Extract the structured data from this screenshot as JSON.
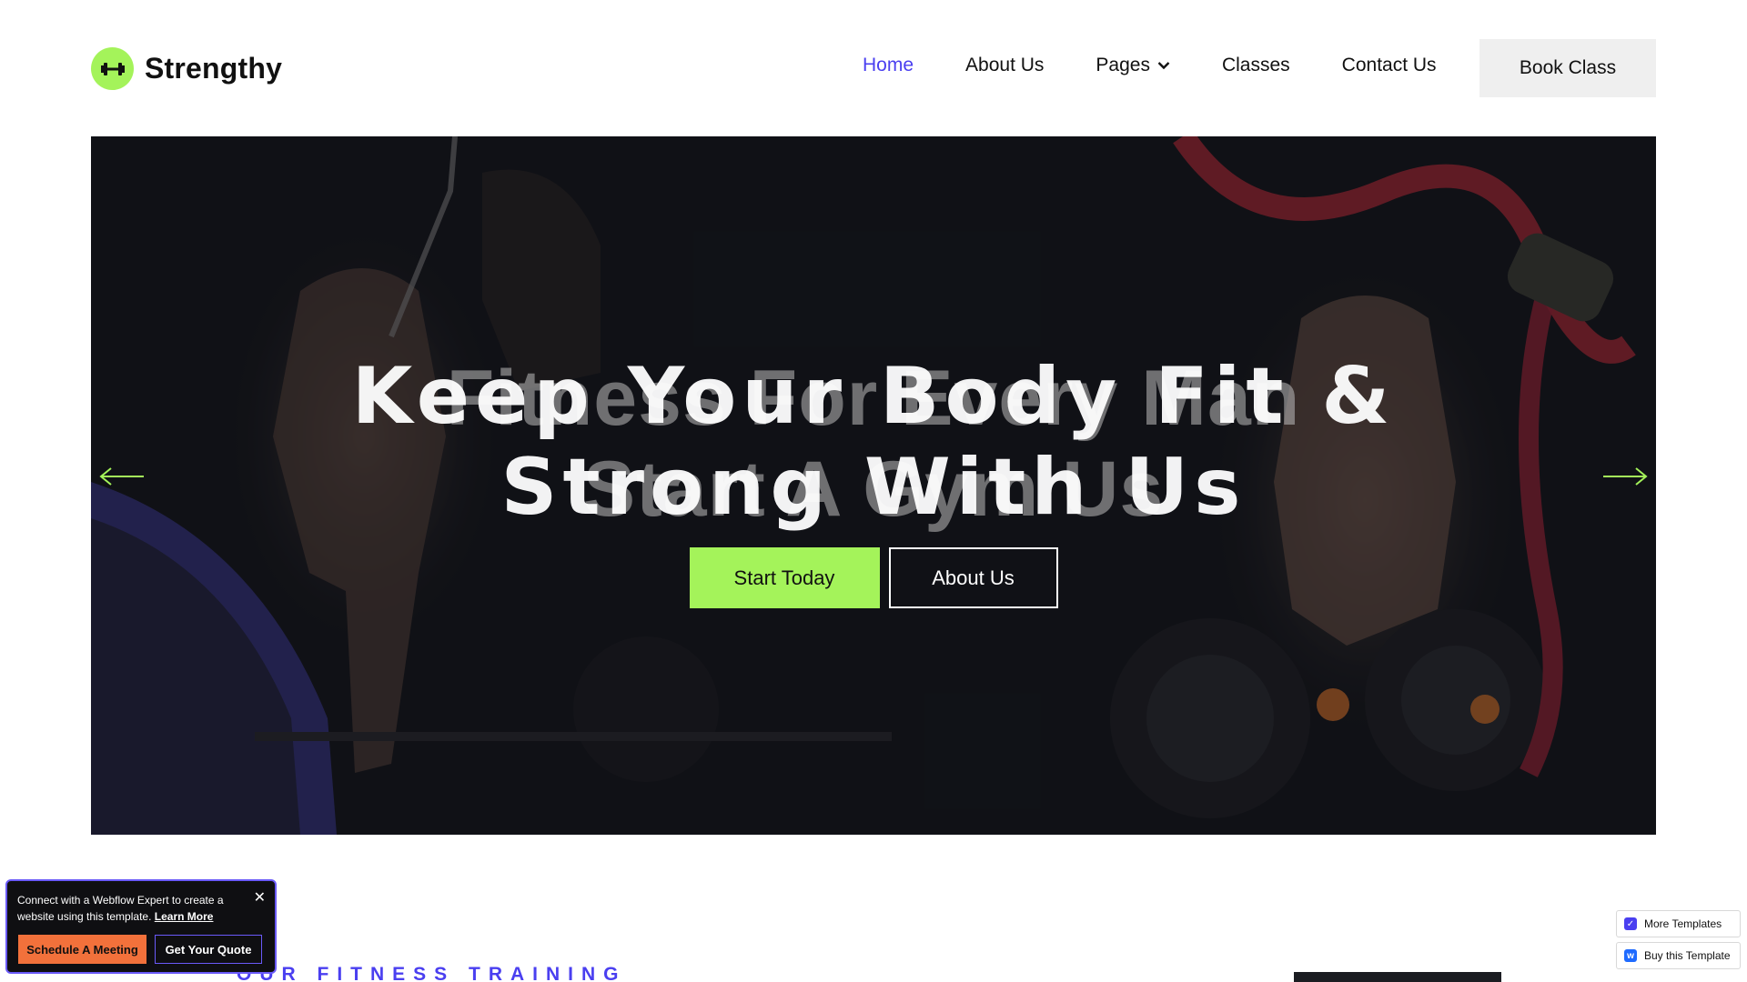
{
  "brand": {
    "name": "Strengthy"
  },
  "nav": {
    "items": [
      {
        "label": "Home",
        "active": true
      },
      {
        "label": "About Us"
      },
      {
        "label": "Pages",
        "has_dropdown": true
      },
      {
        "label": "Classes"
      },
      {
        "label": "Contact Us"
      }
    ],
    "cta_label": "Book Class"
  },
  "hero": {
    "ghost_title_line1": "Fitness For Every Man",
    "ghost_title_line2": "Start A Gym Us",
    "title_line1": "Keep Your Body Fit &",
    "title_line2": "Strong With Us",
    "primary_button": "Start Today",
    "secondary_button": "About Us"
  },
  "section": {
    "eyebrow": "OUR FITNESS TRAINING"
  },
  "webflow_popup": {
    "text": "Connect with a Webflow Expert to create a website using this template.",
    "link": "Learn More",
    "button_primary": "Schedule A Meeting",
    "button_secondary": "Get Your Quote",
    "close": "✕"
  },
  "side_widgets": {
    "more_templates": "More Templates",
    "buy_template": "Buy this Template"
  },
  "colors": {
    "accent_green": "#a4f35a",
    "accent_purple": "#4a3ff0",
    "popup_orange": "#f2713b"
  }
}
